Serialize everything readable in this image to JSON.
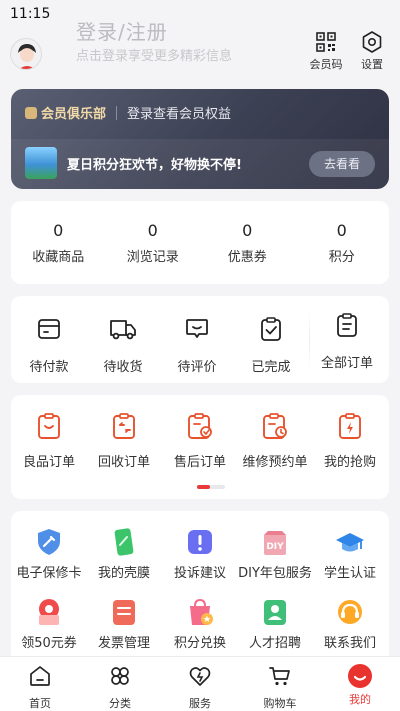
{
  "status_bar": {
    "time": "11:15"
  },
  "header": {
    "login_title": "登录/注册",
    "login_subtitle": "点击登录享受更多精彩信息",
    "member_code_label": "会员码",
    "settings_label": "设置"
  },
  "member_card": {
    "club_name": "会员俱乐部",
    "view_benefits": "登录查看会员权益",
    "promo_text": "夏日积分狂欢节，好物换不停!",
    "promo_button": "去看看"
  },
  "stats": [
    {
      "value": "0",
      "label": "收藏商品"
    },
    {
      "value": "0",
      "label": "浏览记录"
    },
    {
      "value": "0",
      "label": "优惠券"
    },
    {
      "value": "0",
      "label": "积分"
    }
  ],
  "orders": [
    {
      "label": "待付款",
      "icon": "wallet-icon"
    },
    {
      "label": "待收货",
      "icon": "truck-icon"
    },
    {
      "label": "待评价",
      "icon": "comment-icon"
    },
    {
      "label": "已完成",
      "icon": "done-check-icon"
    },
    {
      "label": "全部订单",
      "icon": "all-orders-icon"
    }
  ],
  "services": [
    {
      "label": "良品订单",
      "icon": "quality-order-icon"
    },
    {
      "label": "回收订单",
      "icon": "recycle-order-icon"
    },
    {
      "label": "售后订单",
      "icon": "after-sale-icon"
    },
    {
      "label": "维修预约单",
      "icon": "repair-appointment-icon"
    },
    {
      "label": "我的抢购",
      "icon": "flash-sale-icon"
    }
  ],
  "tools": [
    {
      "label": "电子保修卡",
      "icon": "warranty-card-icon"
    },
    {
      "label": "我的壳膜",
      "icon": "phone-case-icon"
    },
    {
      "label": "投诉建议",
      "icon": "complaint-icon"
    },
    {
      "label": "DIY年包服务",
      "icon": "diy-service-icon"
    },
    {
      "label": "学生认证",
      "icon": "student-cap-icon"
    },
    {
      "label": "领50元券",
      "icon": "coupon-icon"
    },
    {
      "label": "发票管理",
      "icon": "invoice-icon"
    },
    {
      "label": "积分兑换",
      "icon": "points-exchange-icon"
    },
    {
      "label": "人才招聘",
      "icon": "recruitment-icon"
    },
    {
      "label": "联系我们",
      "icon": "customer-service-icon"
    }
  ],
  "diy_badge": "DIY",
  "tab_bar": [
    {
      "label": "首页",
      "icon": "home-icon"
    },
    {
      "label": "分类",
      "icon": "category-icon"
    },
    {
      "label": "服务",
      "icon": "service-heart-icon"
    },
    {
      "label": "购物车",
      "icon": "cart-icon"
    },
    {
      "label": "我的",
      "icon": "me-icon",
      "active": true
    }
  ],
  "colors": {
    "accent": "#e83a3a",
    "card_bg": "#3c4053",
    "page_bg": "#f4f4f6"
  }
}
